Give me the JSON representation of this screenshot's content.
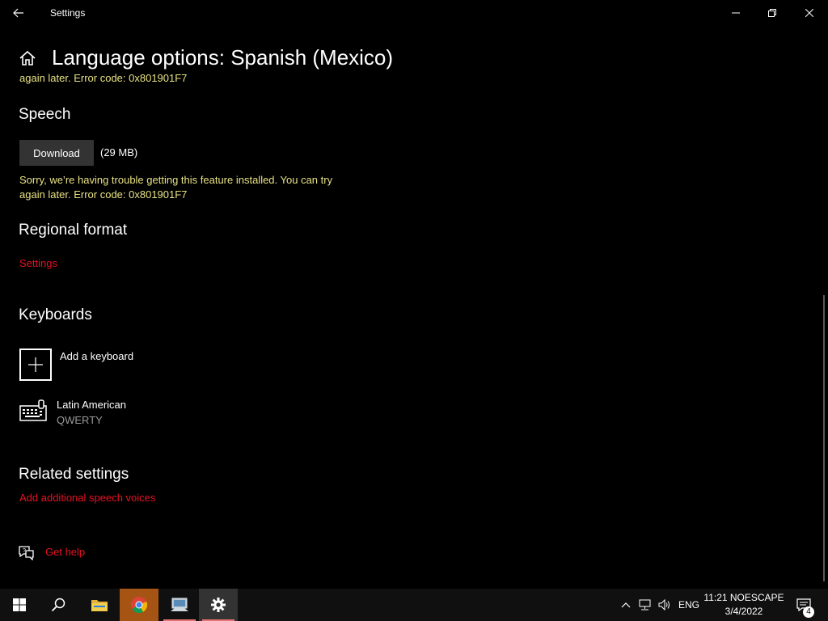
{
  "window": {
    "title": "Settings"
  },
  "header": {
    "title": "Language options: Spanish (Mexico)"
  },
  "clipped_error": "again later. Error code: 0x801901F7",
  "speech": {
    "heading": "Speech",
    "download_label": "Download",
    "size": "(29 MB)",
    "warning_line1": "Sorry, we’re having trouble getting this feature installed. You can try",
    "warning_line2": "again later. Error code: 0x801901F7"
  },
  "regional": {
    "heading": "Regional format",
    "settings_link": "Settings"
  },
  "keyboards": {
    "heading": "Keyboards",
    "add_label": "Add a keyboard",
    "items": [
      {
        "name": "Latin American",
        "layout": "QWERTY"
      }
    ]
  },
  "related": {
    "heading": "Related settings",
    "speech_voices_link": "Add additional speech voices"
  },
  "help": {
    "label": "Get help"
  },
  "taskbar": {
    "language": "ENG",
    "clock_line1": "11:21 NOESCAPE",
    "clock_line2": "3/4/2022",
    "notification_count": "4"
  },
  "colors": {
    "accent_link": "#e81123",
    "warning": "#e8e283",
    "background": "#000000"
  },
  "icons": [
    "back-icon",
    "minimize-icon",
    "maximize-icon",
    "close-icon",
    "home-icon",
    "plus-icon",
    "keyboard-icon",
    "help-icon",
    "windows-icon",
    "search-icon",
    "folder-icon",
    "chrome-icon",
    "app-icon",
    "gear-icon",
    "chevron-up-icon",
    "network-icon",
    "volume-icon",
    "notification-icon"
  ]
}
